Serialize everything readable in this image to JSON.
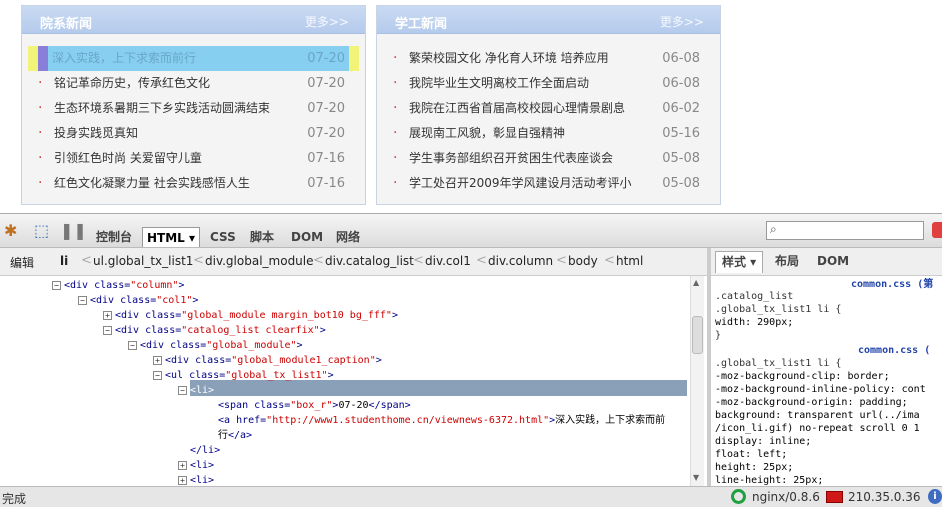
{
  "panels": [
    {
      "title": "院系新闻",
      "more": "更多>>",
      "items": [
        {
          "text": "深入实践，上下求索而前行",
          "date": "07-20",
          "highlighted": true
        },
        {
          "text": "铭记革命历史，传承红色文化",
          "date": "07-20"
        },
        {
          "text": "生态环境系暑期三下乡实践活动圆满结束",
          "date": "07-20"
        },
        {
          "text": "投身实践觅真知",
          "date": "07-20"
        },
        {
          "text": "引领红色时尚 关爱留守儿童",
          "date": "07-16"
        },
        {
          "text": "红色文化凝聚力量 社会实践感悟人生",
          "date": "07-16"
        }
      ]
    },
    {
      "title": "学工新闻",
      "more": "更多>>",
      "items": [
        {
          "text": "繁荣校园文化 净化育人环境 培养应用",
          "date": "06-08"
        },
        {
          "text": "我院毕业生文明离校工作全面启动",
          "date": "06-08"
        },
        {
          "text": "我院在江西省首届高校校园心理情景剧息",
          "date": "06-02"
        },
        {
          "text": "展现南工风貌，彰显自强精神",
          "date": "05-16"
        },
        {
          "text": "学生事务部组织召开贫困生代表座谈会",
          "date": "05-08"
        },
        {
          "text": "学工处召开2009年学风建设月活动考评小",
          "date": "05-08"
        }
      ]
    }
  ],
  "firebug": {
    "tabs": [
      "控制台",
      "HTML ▾",
      "CSS",
      "脚本",
      "DOM",
      "网络"
    ],
    "active_tab": "HTML ▾",
    "edit_label": "编辑",
    "breadcrumbs": [
      "li",
      "ul.global_tx_list1",
      "div.global_module",
      "div.catalog_list",
      "div.col1",
      "div.column",
      "body",
      "html"
    ],
    "side_tabs": [
      "样式 ▾",
      "布局",
      "DOM"
    ],
    "tree": [
      {
        "indent": 0,
        "toggle": "⊟",
        "parts": [
          [
            "tag",
            "<div "
          ],
          [
            "an",
            "class="
          ],
          [
            "av",
            "\"column\""
          ],
          [
            "tag",
            ">"
          ]
        ]
      },
      {
        "indent": 1,
        "toggle": "⊟",
        "parts": [
          [
            "tag",
            "<div "
          ],
          [
            "an",
            "class="
          ],
          [
            "av",
            "\"col1\""
          ],
          [
            "tag",
            ">"
          ]
        ]
      },
      {
        "indent": 2,
        "toggle": "⊞",
        "parts": [
          [
            "tag",
            "<div "
          ],
          [
            "an",
            "class="
          ],
          [
            "av",
            "\"global_module margin_bot10 bg_fff\""
          ],
          [
            "tag",
            ">"
          ]
        ]
      },
      {
        "indent": 2,
        "toggle": "⊟",
        "parts": [
          [
            "tag",
            "<div "
          ],
          [
            "an",
            "class="
          ],
          [
            "av",
            "\"catalog_list clearfix\""
          ],
          [
            "tag",
            ">"
          ]
        ]
      },
      {
        "indent": 3,
        "toggle": "⊟",
        "parts": [
          [
            "tag",
            "<div "
          ],
          [
            "an",
            "class="
          ],
          [
            "av",
            "\"global_module\""
          ],
          [
            "tag",
            ">"
          ]
        ]
      },
      {
        "indent": 4,
        "toggle": "⊞",
        "parts": [
          [
            "tag",
            "<div "
          ],
          [
            "an",
            "class="
          ],
          [
            "av",
            "\"global_module1_caption\""
          ],
          [
            "tag",
            ">"
          ]
        ]
      },
      {
        "indent": 4,
        "toggle": "⊟",
        "parts": [
          [
            "tag",
            "<ul "
          ],
          [
            "an",
            "class="
          ],
          [
            "av",
            "\"global_tx_list1\""
          ],
          [
            "tag",
            ">"
          ]
        ]
      },
      {
        "indent": 5,
        "toggle": "⊟",
        "selected": true,
        "parts": [
          [
            "tag",
            "<li>"
          ]
        ]
      },
      {
        "indent": 6,
        "toggle": "",
        "parts": [
          [
            "tag",
            "<span "
          ],
          [
            "an",
            "class="
          ],
          [
            "av",
            "\"box_r\""
          ],
          [
            "tag",
            ">"
          ],
          [
            "txtc",
            "07-20"
          ],
          [
            "tag",
            "</span>"
          ]
        ]
      },
      {
        "indent": 6,
        "toggle": "",
        "parts": [
          [
            "tag",
            "<a "
          ],
          [
            "an",
            "href="
          ],
          [
            "av",
            "\"http://www1.studenthome.cn/viewnews-6372.html\""
          ],
          [
            "tag",
            ">"
          ],
          [
            "txtc",
            "深入实践，上下求索而前"
          ]
        ]
      },
      {
        "indent": 6,
        "toggle": "",
        "parts": [
          [
            "txtc",
            "行"
          ],
          [
            "tag",
            "</a>"
          ]
        ]
      },
      {
        "indent": 5,
        "toggle": "",
        "parts": [
          [
            "tag",
            "</li>"
          ]
        ]
      },
      {
        "indent": 5,
        "toggle": "⊞",
        "parts": [
          [
            "tag",
            "<li>"
          ]
        ]
      },
      {
        "indent": 5,
        "toggle": "⊞",
        "parts": [
          [
            "tag",
            "<li>"
          ]
        ]
      }
    ],
    "css": [
      {
        "kind": "src",
        "text": "common.css (第"
      },
      {
        "kind": "sel",
        "text": ".catalog_list"
      },
      {
        "kind": "sel",
        "text": ".global_tx_list1 li {"
      },
      {
        "kind": "prop",
        "text": "  width: 290px;"
      },
      {
        "kind": "sel",
        "text": "}"
      },
      {
        "kind": "src",
        "text": "common.css ("
      },
      {
        "kind": "sel",
        "text": ".global_tx_list1 li {"
      },
      {
        "kind": "prop",
        "text": "  -moz-background-clip: border;"
      },
      {
        "kind": "prop",
        "text": "  -moz-background-inline-policy: cont"
      },
      {
        "kind": "prop",
        "text": "  -moz-background-origin: padding;"
      },
      {
        "kind": "prop",
        "text": "  background: transparent url(../ima"
      },
      {
        "kind": "prop",
        "text": "  /icon_li.gif) no-repeat scroll 0 1"
      },
      {
        "kind": "prop",
        "text": "  display: inline;"
      },
      {
        "kind": "prop",
        "text": "  float: left;"
      },
      {
        "kind": "prop",
        "text": "  height: 25px;"
      },
      {
        "kind": "prop",
        "text": "  line-height: 25px;"
      },
      {
        "kind": "prop",
        "text": "  margin: 0 15px 0 20px;"
      }
    ],
    "status": {
      "left": "完成",
      "server": "nginx/0.8.6",
      "ip": "210.35.0.36"
    }
  }
}
